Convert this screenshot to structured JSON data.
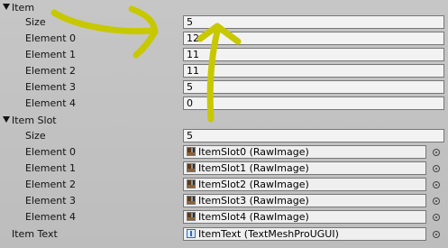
{
  "inspector": {
    "item_section": {
      "header": "Item",
      "size_label": "Size",
      "size_value": "5",
      "elements": [
        {
          "label": "Element 0",
          "value": "12"
        },
        {
          "label": "Element 1",
          "value": "11"
        },
        {
          "label": "Element 2",
          "value": "11"
        },
        {
          "label": "Element 3",
          "value": "5"
        },
        {
          "label": "Element 4",
          "value": "0"
        }
      ]
    },
    "item_slot_section": {
      "header": "Item Slot",
      "size_label": "Size",
      "size_value": "5",
      "elements": [
        {
          "label": "Element 0",
          "value": "ItemSlot0 (RawImage)"
        },
        {
          "label": "Element 1",
          "value": "ItemSlot1 (RawImage)"
        },
        {
          "label": "Element 2",
          "value": "ItemSlot2 (RawImage)"
        },
        {
          "label": "Element 3",
          "value": "ItemSlot3 (RawImage)"
        },
        {
          "label": "Element 4",
          "value": "ItemSlot4 (RawImage)"
        }
      ]
    },
    "item_text": {
      "label": "Item Text",
      "value": "ItemText (TextMeshProUGUI)"
    }
  },
  "icons": {
    "fold": "triangle-down-icon",
    "raw_image": "raw-image-icon",
    "text_mesh_pro": "text-mesh-pro-icon",
    "object_picker": "object-picker-icon"
  },
  "annotation": {
    "color": "#c8c800"
  }
}
